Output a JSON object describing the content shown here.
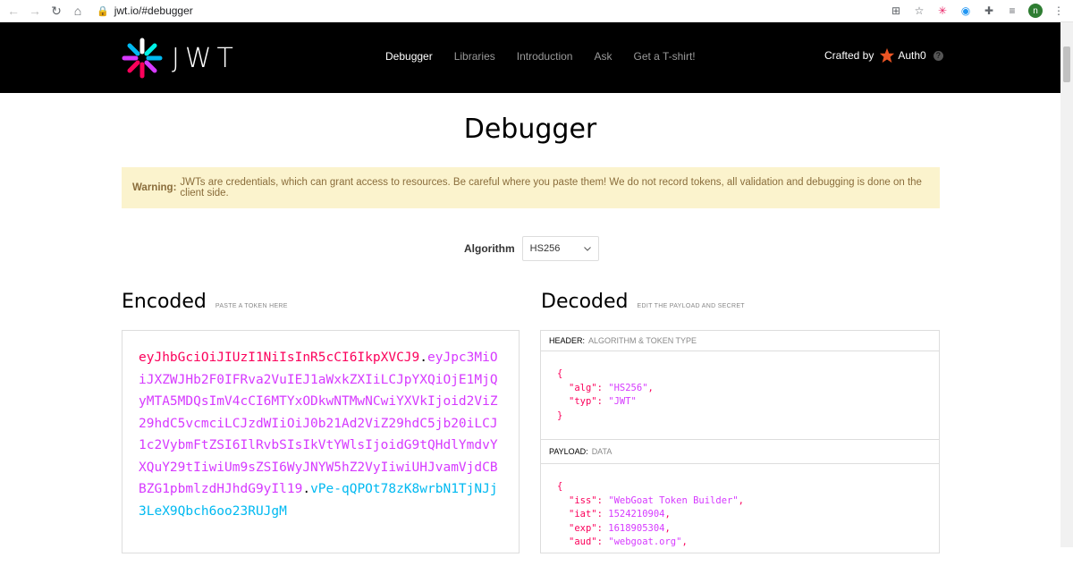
{
  "browser": {
    "url": "jwt.io/#debugger",
    "profile_initial": "n"
  },
  "nav": {
    "logo_text": "JWT",
    "links": [
      "Debugger",
      "Libraries",
      "Introduction",
      "Ask",
      "Get a T-shirt!"
    ],
    "active": "Debugger",
    "crafted_by": "Crafted by",
    "brand": "Auth0",
    "help": "?"
  },
  "page": {
    "title": "Debugger",
    "warning_label": "Warning:",
    "warning_text": "JWTs are credentials, which can grant access to resources. Be careful where you paste them! We do not record tokens, all validation and debugging is done on the client side.",
    "algorithm_label": "Algorithm",
    "algorithm_value": "HS256"
  },
  "encoded": {
    "title": "Encoded",
    "subtitle": "PASTE A TOKEN HERE",
    "header_part": "eyJhbGciOiJIUzI1NiIsInR5cCI6IkpXVCJ9",
    "payload_part": "eyJpc3MiOiJXZWJHb2F0IFRva2VuIEJ1aWxkZXIiLCJpYXQiOjE1MjQyMTA5MDQsImV4cCI6MTYxODkwNTMwNCwiYXVkIjoid2ViZ29hdC5vcmciLCJzdWIiOiJ0b21Ad2ViZ29hdC5jb20iLCJ1c2VybmFtZSI6IlRvbSIsIkVtYWlsIjoidG9tQHdlYmdvYXQuY29tIiwiUm9sZSI6WyJNYW5hZ2VyIiwiUHJvamVjdCBBZG1pbmlzdHJhdG9yIl19",
    "signature_part": "vPe-qQPOt78zK8wrbN1TjNJj3LeX9Qbch6oo23RUJgM",
    "dot": "."
  },
  "decoded": {
    "title": "Decoded",
    "subtitle": "EDIT THE PAYLOAD AND SECRET",
    "header_label": "HEADER:",
    "header_sub": "ALGORITHM & TOKEN TYPE",
    "header_json": [
      {
        "key": "\"alg\"",
        "value": "\"HS256\"",
        "comma": ","
      },
      {
        "key": "\"typ\"",
        "value": "\"JWT\"",
        "comma": ""
      }
    ],
    "payload_label": "PAYLOAD:",
    "payload_sub": "DATA",
    "payload_json": [
      {
        "key": "\"iss\"",
        "value": "\"WebGoat Token Builder\"",
        "comma": ","
      },
      {
        "key": "\"iat\"",
        "value": "1524210904",
        "comma": ","
      },
      {
        "key": "\"exp\"",
        "value": "1618905304",
        "comma": ","
      },
      {
        "key": "\"aud\"",
        "value": "\"webgoat.org\"",
        "comma": ","
      }
    ],
    "brace_open": "{",
    "brace_close": "}"
  },
  "colors": {
    "header": "#fb015b",
    "payload": "#d63aff",
    "signature": "#00b9f1",
    "warning_bg": "#fbf3cd"
  }
}
